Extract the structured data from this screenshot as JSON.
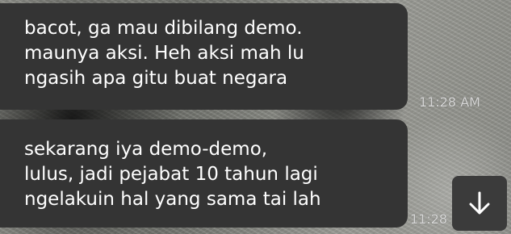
{
  "messages": [
    {
      "lines": [
        "bacot, ga mau dibilang demo.",
        "maunya aksi. Heh aksi mah lu",
        "ngasih apa gitu buat negara"
      ],
      "time": "11:28 AM"
    },
    {
      "lines": [
        "sekarang iya demo-demo,",
        "lulus, jadi pejabat 10 tahun lagi",
        "ngelakuin hal yang sama tai lah"
      ],
      "time": "11:28 AM"
    }
  ],
  "scroll_button": {
    "icon": "arrow-down-icon"
  },
  "colors": {
    "bubble": "#343434",
    "text": "#ffffff"
  }
}
